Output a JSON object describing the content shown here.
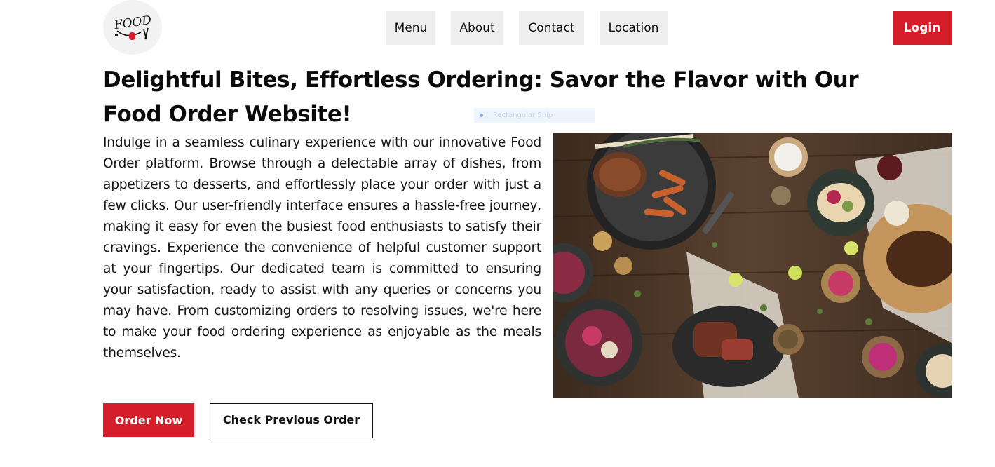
{
  "header": {
    "logo_text": "FOOD",
    "nav": [
      "Menu",
      "About",
      "Contact",
      "Location"
    ],
    "login_label": "Login"
  },
  "hero": {
    "headline": "Delightful Bites, Effortless Ordering: Savor the Flavor with Our Food Order Website!",
    "description": "Indulge in a seamless culinary experience with our innovative Food Order platform. Browse through a delectable array of dishes, from appetizers to desserts, and effortlessly place your order with just a few clicks. Our user-friendly interface ensures a hassle-free journey, making it easy for even the busiest food enthusiasts to satisfy their cravings. Experience the convenience of helpful customer support at your fingertips. Our dedicated team is committed to ensuring your satisfaction, ready to assist with any queries or concerns you may have. From customizing orders to resolving issues, we're here to make your food ordering experience as enjoyable as the meals themselves.",
    "order_now_label": "Order Now",
    "check_previous_label": "Check Previous Order"
  },
  "overlay": {
    "snip_label": "Rectangular Snip"
  },
  "colors": {
    "accent": "#d41f2b",
    "nav_bg": "#eeeeee",
    "text": "#111111"
  }
}
